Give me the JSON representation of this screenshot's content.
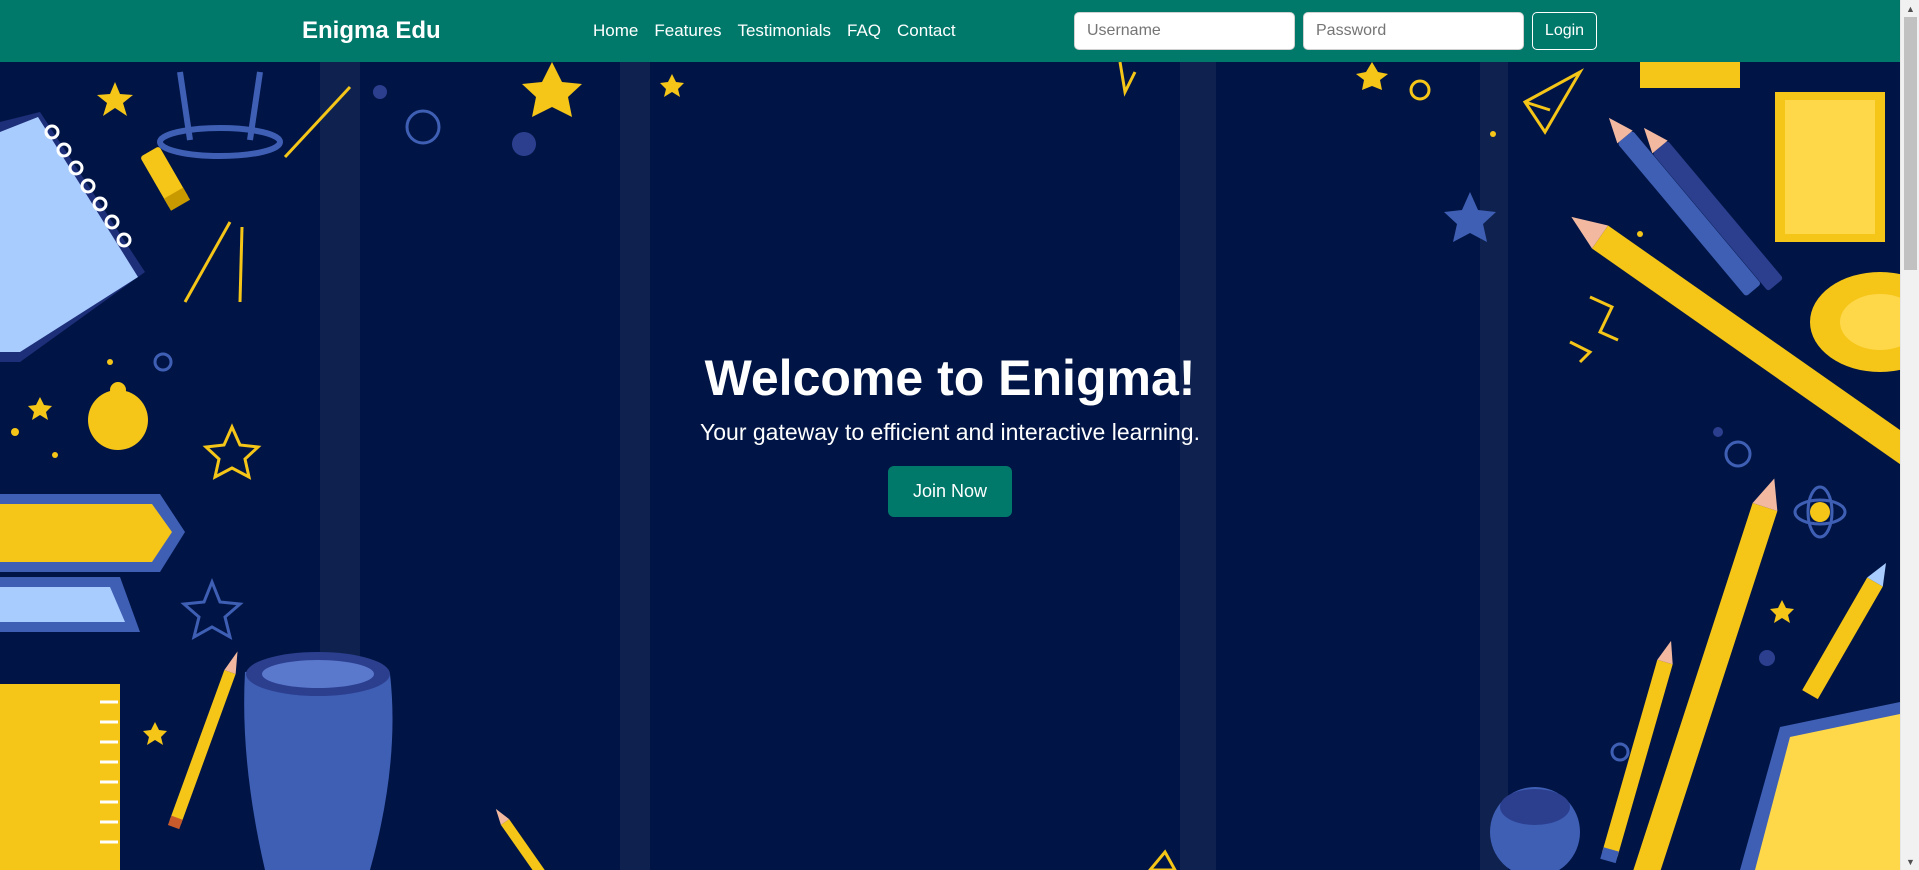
{
  "navbar": {
    "brand": "Enigma Edu",
    "links": [
      "Home",
      "Features",
      "Testimonials",
      "FAQ",
      "Contact"
    ],
    "username_placeholder": "Username",
    "password_placeholder": "Password",
    "login_label": "Login"
  },
  "hero": {
    "title": "Welcome to Enigma!",
    "subtitle": "Your gateway to efficient and interactive learning.",
    "cta_label": "Join Now"
  },
  "colors": {
    "navbar_bg": "#00796b",
    "hero_bg": "#001545",
    "accent_yellow": "#f5c518",
    "accent_blue": "#3f5fb5"
  },
  "icons": [
    "arrow-up-icon",
    "arrow-down-icon"
  ]
}
